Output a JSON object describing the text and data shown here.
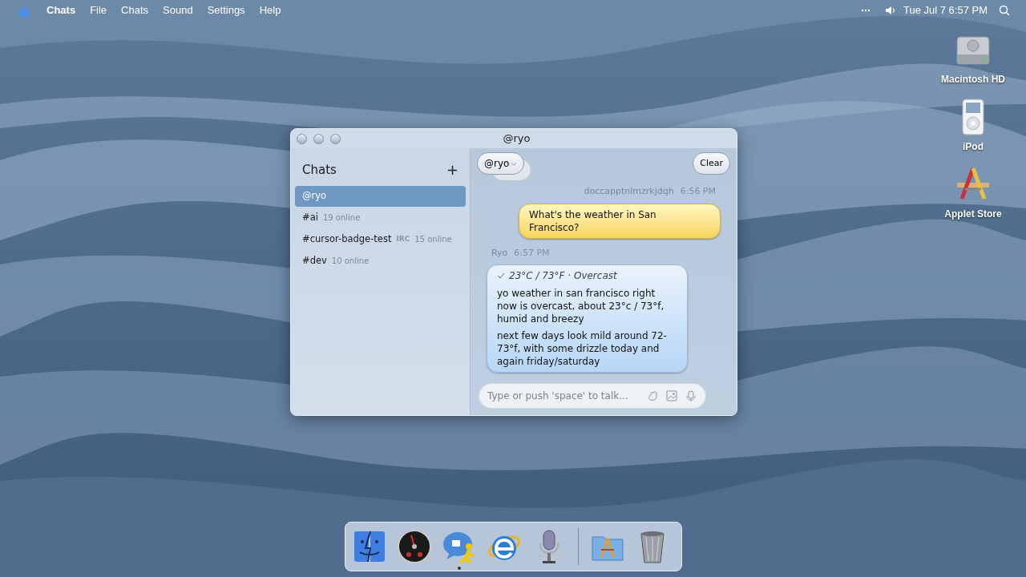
{
  "menubar": {
    "app": "Chats",
    "menus": [
      "File",
      "Chats",
      "Sound",
      "Settings",
      "Help"
    ],
    "clock": "Tue Jul 7 6:57 PM"
  },
  "desktop_icons": [
    {
      "kind": "drive",
      "label": "Macintosh HD"
    },
    {
      "kind": "ipod",
      "label": "iPod"
    },
    {
      "kind": "store",
      "label": "Applet Store"
    }
  ],
  "window": {
    "title": "@ryo",
    "sidebar": {
      "title": "Chats",
      "add": "+",
      "items": [
        {
          "name": "@ryo",
          "selected": true
        },
        {
          "name": "#ai",
          "count": "19 online",
          "selected": false
        },
        {
          "name": "#cursor-badge-test",
          "badge": "IRC",
          "count": "15 online",
          "selected": false
        },
        {
          "name": "#dev",
          "count": "10 online",
          "selected": false
        }
      ]
    },
    "chat": {
      "recipient": "@ryo",
      "clear": "Clear",
      "messages": [
        {
          "kind": "outgoing",
          "sender": "doccapptnlmzrkjdqh",
          "time": "6:56 PM",
          "paragraphs": [
            "What's the weather in San Francisco?"
          ]
        },
        {
          "kind": "incoming",
          "sender": "Ryo",
          "time": "6:57 PM",
          "tool_result": "23°C / 73°F · Overcast",
          "paragraphs": [
            "yo weather in san francisco right now is overcast, about 23°c / 73°f, humid and breezy",
            "next few days look mild around 72-73°f, with some drizzle today and again friday/saturday"
          ]
        }
      ],
      "input": {
        "placeholder": "Type or push 'space' to talk..."
      }
    }
  },
  "dock": [
    {
      "kind": "finder",
      "running": false
    },
    {
      "kind": "dashboard",
      "running": false
    },
    {
      "kind": "chat",
      "running": true
    },
    {
      "kind": "browser",
      "running": false
    },
    {
      "kind": "microphone",
      "running": false
    },
    {
      "kind": "separator"
    },
    {
      "kind": "applications",
      "running": false
    },
    {
      "kind": "trash",
      "running": false
    }
  ]
}
